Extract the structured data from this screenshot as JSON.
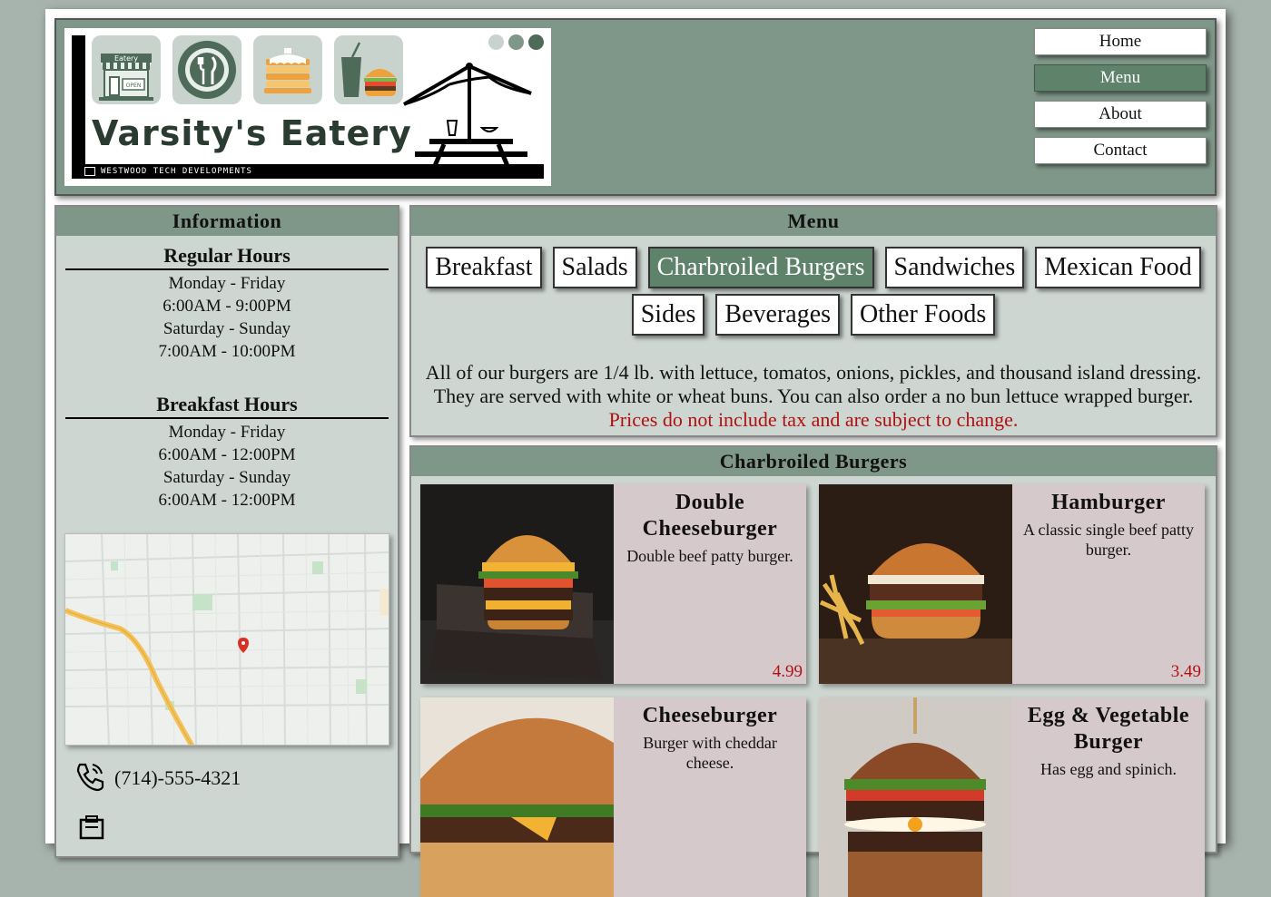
{
  "brand": {
    "name": "Varsity's Eatery",
    "subtitle": "WESTWOOD TECH DEVELOPMENTS",
    "store_sign": "Eatery",
    "door_sign": "OPEN"
  },
  "nav": {
    "items": [
      {
        "label": "Home",
        "active": false
      },
      {
        "label": "Menu",
        "active": true
      },
      {
        "label": "About",
        "active": false
      },
      {
        "label": "Contact",
        "active": false
      }
    ]
  },
  "sidebar": {
    "title": "Information",
    "regular": {
      "title": "Regular Hours",
      "lines": [
        "Monday - Friday",
        "6:00AM - 9:00PM",
        "Saturday - Sunday",
        "7:00AM - 10:00PM"
      ]
    },
    "breakfast": {
      "title": "Breakfast Hours",
      "lines": [
        "Monday - Friday",
        "6:00AM - 12:00PM",
        "Saturday - Sunday",
        "6:00AM - 12:00PM"
      ]
    },
    "phone": "(714)-555-4321"
  },
  "menu": {
    "title": "Menu",
    "tabs": [
      {
        "label": "Breakfast",
        "active": false
      },
      {
        "label": "Salads",
        "active": false
      },
      {
        "label": "Charbroiled Burgers",
        "active": true
      },
      {
        "label": "Sandwiches",
        "active": false
      },
      {
        "label": "Mexican Food",
        "active": false
      },
      {
        "label": "Sides",
        "active": false
      },
      {
        "label": "Beverages",
        "active": false
      },
      {
        "label": "Other Foods",
        "active": false
      }
    ],
    "desc_line1": "All of our burgers are 1/4 lb. with lettuce, tomatos, onions, pickles, and thousand island dressing.",
    "desc_line2": "They are served with white or wheat buns. You can also order a no bun lettuce wrapped burger.",
    "price_note": "Prices do not include tax and are subject to change."
  },
  "burgers": {
    "title": "Charbroiled Burgers",
    "items": [
      {
        "name": "Double Cheeseburger",
        "desc": "Double beef patty burger.",
        "price": "4.99"
      },
      {
        "name": "Hamburger",
        "desc": "A classic single beef patty burger.",
        "price": "3.49"
      },
      {
        "name": "Cheeseburger",
        "desc": "Burger with cheddar cheese.",
        "price": ""
      },
      {
        "name": "Egg & Vegetable Burger",
        "desc": "Has egg and spinich.",
        "price": ""
      }
    ]
  },
  "colors": {
    "accent": "#7f9788",
    "active": "#5f826b",
    "panel": "#cdd6d1",
    "card": "#d6c9cc",
    "price": "#b01010"
  }
}
